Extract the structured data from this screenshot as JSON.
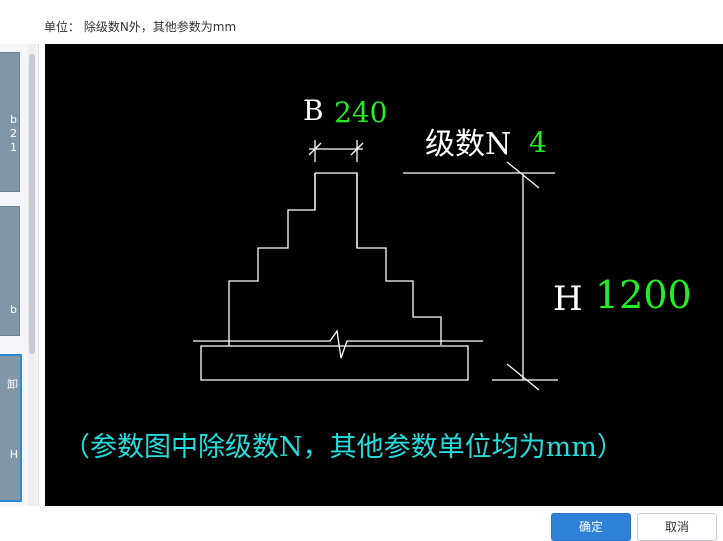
{
  "unit_note": "单位： 除级数N外，其他参数为mm",
  "left_panel": {
    "thumb1_glyphs": [
      "b",
      "2",
      "1"
    ],
    "thumb2_glyph": "b",
    "thumb3_glyphs": [
      "卸",
      "H"
    ]
  },
  "diagram": {
    "b_label": "B",
    "b_value": "240",
    "n_label": "级数N",
    "n_value": "4",
    "h_label": "H",
    "h_value": "1200",
    "note": "（参数图中除级数N，其他参数单位均为mm）",
    "colors": {
      "background": "#000000",
      "lines": "#ffffff",
      "label": "#ffffff",
      "value": "#22ee22",
      "note": "#22dddd"
    }
  },
  "buttons": {
    "ok": "确定",
    "cancel": "取消"
  }
}
